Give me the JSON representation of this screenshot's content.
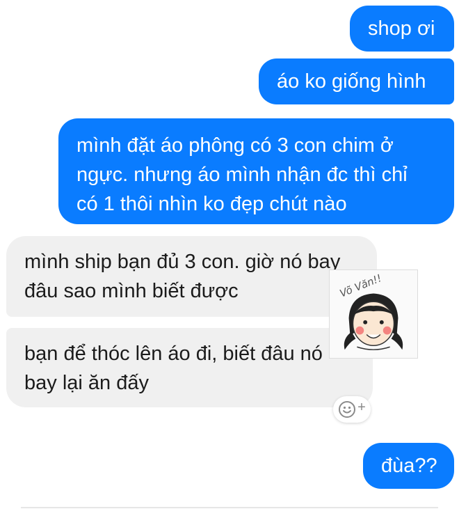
{
  "messages": [
    {
      "direction": "outgoing",
      "lines": [
        "shop ơi"
      ]
    },
    {
      "direction": "outgoing",
      "lines": [
        "áo ko giống hình"
      ]
    },
    {
      "direction": "outgoing",
      "lines": [
        "mình đặt áo phông có 3 con chim ở",
        "ngực. nhưng áo mình nhận đc thì chỉ",
        "có 1 thôi nhìn ko đẹp chút nào"
      ]
    },
    {
      "direction": "incoming",
      "lines": [
        "mình ship bạn đủ 3 con. giờ nó bay",
        "đâu sao mình biết được"
      ]
    },
    {
      "direction": "incoming",
      "lines": [
        "bạn để thóc lên áo đi, biết đâu nó",
        "bay lại ăn đấy"
      ]
    },
    {
      "direction": "outgoing",
      "lines": [
        "đùa??"
      ]
    }
  ],
  "sticker": {
    "text": "Võ Văn!!"
  },
  "reaction_button": {
    "icon": "smiley-icon",
    "plus": "+"
  },
  "colors": {
    "outgoing_bubble": "#0a7cff",
    "incoming_bubble": "#f0f0f0"
  }
}
